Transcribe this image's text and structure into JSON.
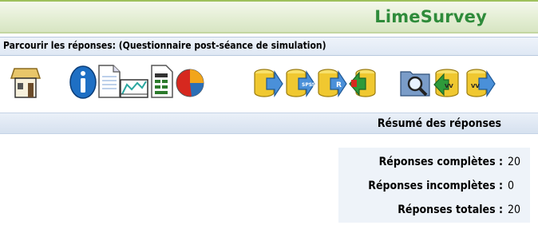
{
  "app": {
    "brand": "LimeSurvey"
  },
  "page": {
    "title": "Parcourir les réponses: (Questionnaire post-séance de simulation)"
  },
  "toolbar": {
    "icons": [
      "home-icon",
      "info-icon",
      "document-icon",
      "chart-icon",
      "report-icon",
      "pie-chart-icon",
      "export-icon",
      "export-spss-icon",
      "export-r-icon",
      "import-icon",
      "search-database-icon",
      "import-vv-icon",
      "export-vv-icon"
    ],
    "badges": {
      "spss": "SPSS",
      "r": "R",
      "vv": "VV"
    }
  },
  "summary": {
    "title": "Résumé des réponses",
    "rows": [
      {
        "label": "Réponses complètes :",
        "value": "20"
      },
      {
        "label": "Réponses incomplètes :",
        "value": "0"
      },
      {
        "label": "Réponses totales :",
        "value": "20"
      }
    ]
  },
  "colors": {
    "brand": "#2e8b3a",
    "header_bg": "#e4eed4",
    "bar_bg": "#dfe8f4",
    "stats_bg": "#eef3f9"
  }
}
